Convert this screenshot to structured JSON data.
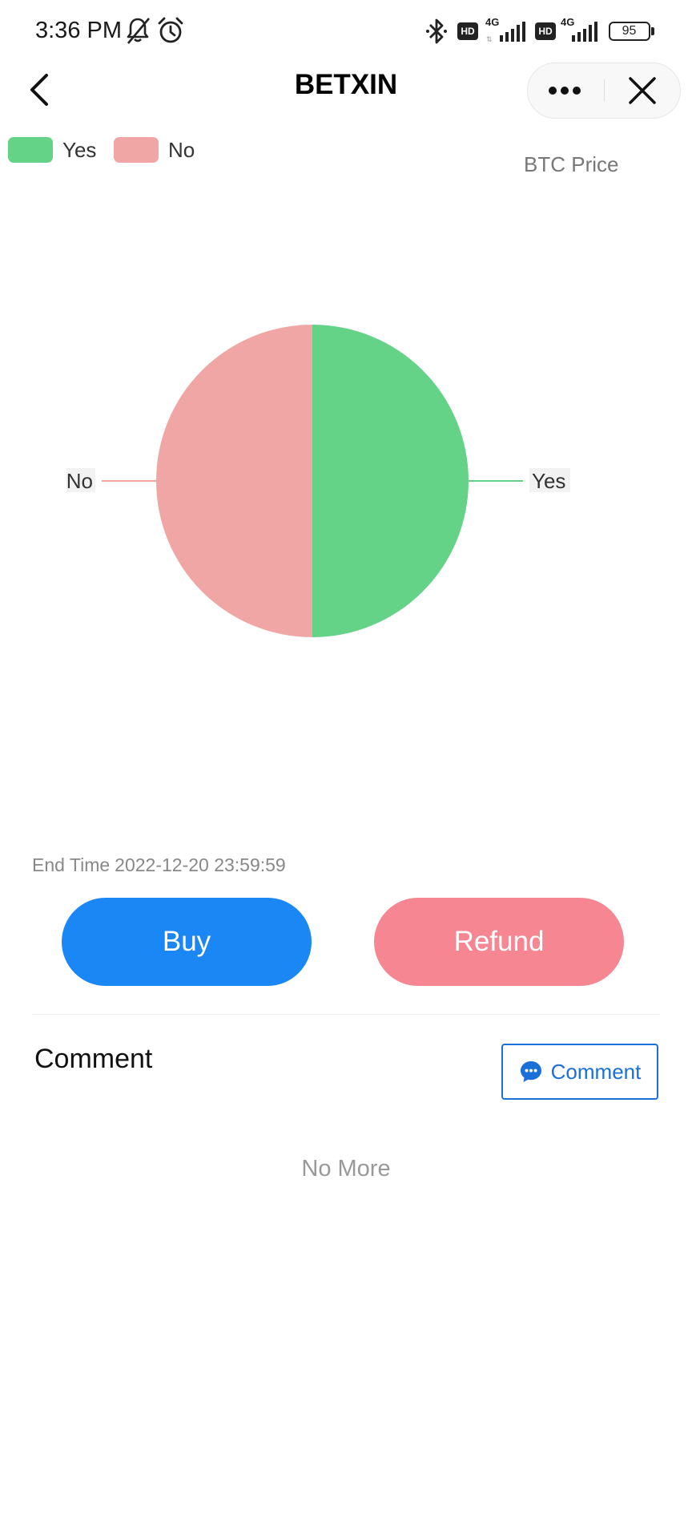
{
  "status_bar": {
    "time": "3:36 PM",
    "network_1": "4G",
    "network_2": "4G",
    "hd_1": "HD",
    "hd_2": "HD",
    "battery": "95",
    "icons": [
      "bell-off-icon",
      "alarm-icon",
      "bluetooth-icon",
      "signal-icon",
      "battery-icon"
    ]
  },
  "header": {
    "title": "BETXIN",
    "icons": [
      "back-arrow-icon",
      "more-icon",
      "close-icon"
    ]
  },
  "legend": {
    "items": [
      {
        "label": "Yes",
        "color": "#64d287"
      },
      {
        "label": "No",
        "color": "#f1a6a6"
      }
    ]
  },
  "btc_price_label": "BTC Price",
  "chart_data": {
    "type": "pie",
    "categories": [
      "Yes",
      "No"
    ],
    "values": [
      50,
      50
    ],
    "colors": [
      "#64d287",
      "#f1a6a6"
    ],
    "legend_position": "top-left"
  },
  "end_time": {
    "label": "End Time",
    "value": "2022-12-20 23:59:59"
  },
  "actions": {
    "buy_label": "Buy",
    "refund_label": "Refund",
    "buy_color": "#1a87f5",
    "refund_color": "#f68692"
  },
  "comments": {
    "heading": "Comment",
    "button_label": "Comment",
    "button_icon": "chat-bubble-icon",
    "empty_text": "No More"
  }
}
